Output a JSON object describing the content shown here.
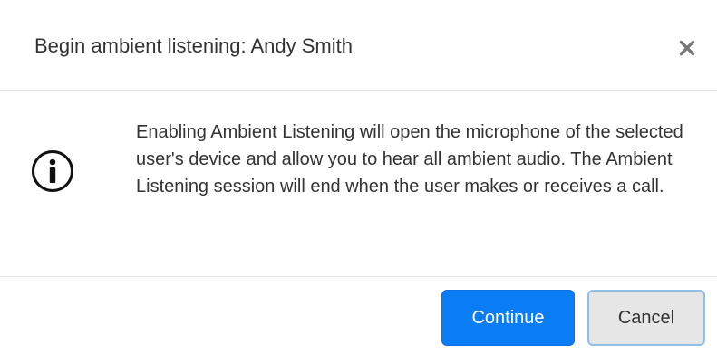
{
  "dialog": {
    "title": "Begin ambient listening: Andy Smith",
    "close_icon": "close-icon",
    "info_icon": "info-icon",
    "message": "Enabling Ambient Listening will open the microphone of the selected user's device and allow you to hear all ambient audio. The Ambient Listening session will end when the user makes or receives a call.",
    "buttons": {
      "continue_label": "Continue",
      "cancel_label": "Cancel"
    }
  },
  "colors": {
    "primary": "#0a7cf6",
    "cancel_bg": "#e6e6e6",
    "cancel_border": "#8fbfe8",
    "text": "#333333",
    "divider": "#e5e5e5",
    "close_icon": "#777777"
  }
}
